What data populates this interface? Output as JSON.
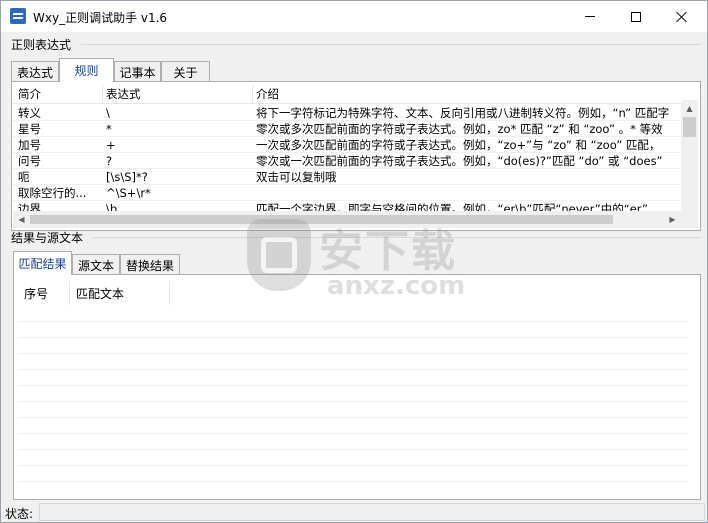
{
  "window": {
    "title": "Wxy_正则调试助手  v1.6"
  },
  "regex_group": {
    "label": "正则表达式",
    "tabs": [
      "表达式",
      "规则",
      "记事本",
      "关于"
    ],
    "active_tab": 1
  },
  "rules_table": {
    "headers": [
      "简介",
      "表达式",
      "介绍"
    ],
    "rows": [
      [
        "转义",
        "\\",
        "将下一字符标记为特殊字符、文本、反向引用或八进制转义符。例如，“n” 匹配字"
      ],
      [
        "星号",
        "*",
        "零次或多次匹配前面的字符或子表达式。例如，zo* 匹配 “z” 和 “zoo” 。* 等效"
      ],
      [
        "加号",
        "+",
        "一次或多次匹配前面的字符或子表达式。例如，“zo+”与 “zo” 和 “zoo” 匹配，"
      ],
      [
        "问号",
        "?",
        "零次或一次匹配前面的字符或子表达式。例如，“do(es)?”匹配 “do” 或 “does”"
      ],
      [
        "呃",
        "[\\s\\S]*?",
        "双击可以复制哦"
      ],
      [
        "取除空行的...",
        "^\\S+\\r*",
        ""
      ],
      [
        "边界",
        "\\b",
        "匹配一个字边界，即字与空格间的位置。例如，“er\\b”匹配“never”中的“er”"
      ]
    ]
  },
  "results_group": {
    "label": "结果与源文本",
    "tabs": [
      "匹配结果",
      "源文本",
      "替换结果"
    ],
    "active_tab": 0,
    "columns": [
      "序号",
      "匹配文本"
    ]
  },
  "watermark": {
    "big": "安下载",
    "small": "anxz.com"
  },
  "status": {
    "label": "状态:",
    "value": ""
  },
  "colors": {
    "tab_active_text": "#1a3f8a",
    "brand_icon": "#2a6ab8"
  }
}
